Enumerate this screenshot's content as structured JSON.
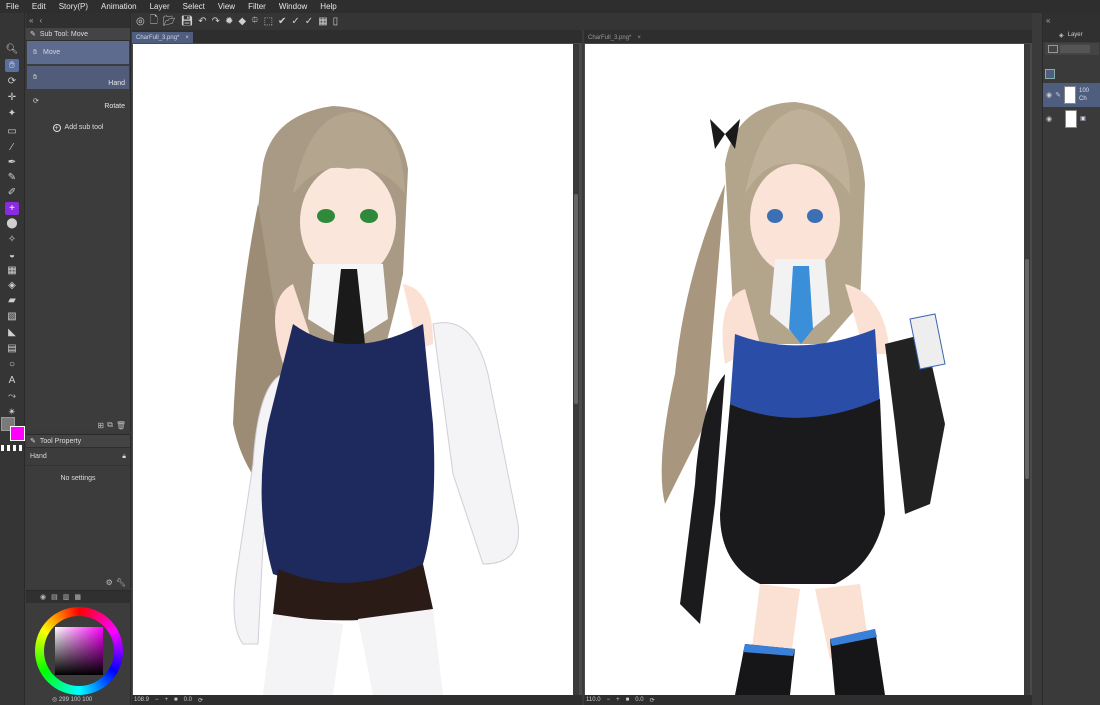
{
  "menu": [
    "File",
    "Edit",
    "Story(P)",
    "Animation",
    "Layer",
    "Select",
    "View",
    "Filter",
    "Window",
    "Help"
  ],
  "subtool_panel": {
    "title": "Sub Tool: Move",
    "items": [
      {
        "name": "Move",
        "label_pos": "left"
      },
      {
        "name": "Hand",
        "label_pos": "right"
      },
      {
        "name": "Rotate",
        "label_pos": "right"
      }
    ],
    "add_label": "Add sub tool"
  },
  "tool_property": {
    "title": "Tool Property",
    "tool_name": "Hand",
    "message": "No settings"
  },
  "color": {
    "main": "#7a7a7a",
    "sub": "#ff00ff",
    "hsv_readout": "299 100 100"
  },
  "views": [
    {
      "tab": "CharFull_3.png*",
      "zoom": "108.9",
      "angle": "0.0",
      "active": true
    },
    {
      "tab": "CharFull_3.png*",
      "zoom": "110.0",
      "angle": "0.0",
      "active": false
    }
  ],
  "layer_panel": {
    "title": "Layer",
    "layers": [
      {
        "text_line1": "100",
        "text_line2": "Ch",
        "selected": true
      },
      {
        "text_line1": "",
        "text_line2": "",
        "selected": false
      }
    ]
  },
  "icons": [
    "move-icon",
    "hand-icon",
    "rotate-icon",
    "magnifier-icon",
    "pen-icon",
    "eraser-icon",
    "text-icon",
    "undo-icon",
    "redo-icon"
  ]
}
